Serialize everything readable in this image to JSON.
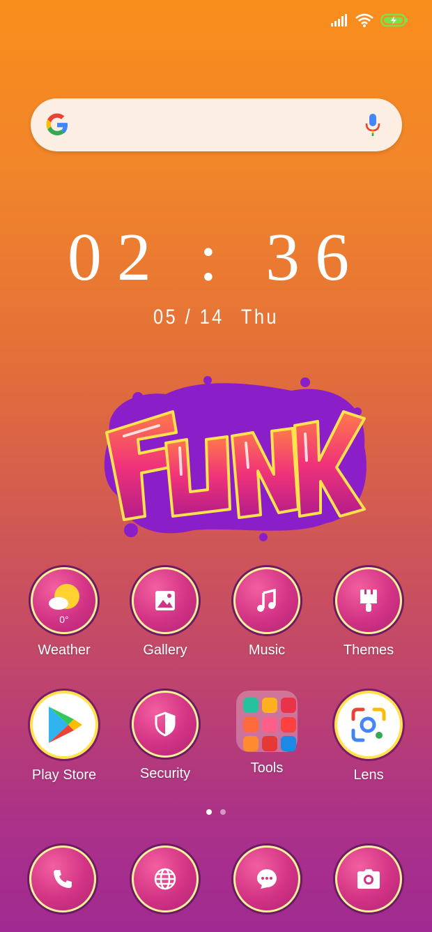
{
  "clock": {
    "time": "02 : 36",
    "month_day": "05 / 14",
    "weekday": "Thu"
  },
  "row1": [
    {
      "label": "Weather",
      "icon": "weather-icon",
      "badge": "0°"
    },
    {
      "label": "Gallery",
      "icon": "gallery-icon"
    },
    {
      "label": "Music",
      "icon": "music-icon"
    },
    {
      "label": "Themes",
      "icon": "themes-icon"
    }
  ],
  "row2": [
    {
      "label": "Play Store",
      "icon": "play-store-icon"
    },
    {
      "label": "Security",
      "icon": "shield-icon"
    },
    {
      "label": "Tools",
      "icon": "folder-icon"
    },
    {
      "label": "Lens",
      "icon": "lens-icon"
    }
  ],
  "dock": [
    {
      "icon": "phone-icon"
    },
    {
      "icon": "browser-icon"
    },
    {
      "icon": "messages-icon"
    },
    {
      "icon": "camera-icon"
    }
  ],
  "page_indicator": {
    "pages": 2,
    "current": 1
  },
  "colors": {
    "icon_ring": "#fff19a",
    "icon_fill": "#d23384",
    "search_bg": "#fdeee3"
  }
}
